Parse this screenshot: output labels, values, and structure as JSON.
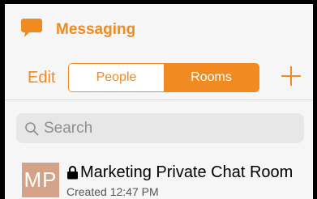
{
  "header": {
    "title": "Messaging",
    "icon": "chat-bubble-icon"
  },
  "toolbar": {
    "edit_label": "Edit",
    "segments": [
      {
        "label": "People",
        "selected": false
      },
      {
        "label": "Rooms",
        "selected": true
      }
    ],
    "add_icon": "plus-icon"
  },
  "search": {
    "placeholder": "Search",
    "value": ""
  },
  "rooms": [
    {
      "initials": "MP",
      "name": "Marketing Private Chat Room",
      "subtitle": "Created 12:47 PM",
      "locked": true
    }
  ],
  "colors": {
    "accent": "#f08a21",
    "avatar": "#d4a287",
    "background": "#f6f6f6"
  }
}
